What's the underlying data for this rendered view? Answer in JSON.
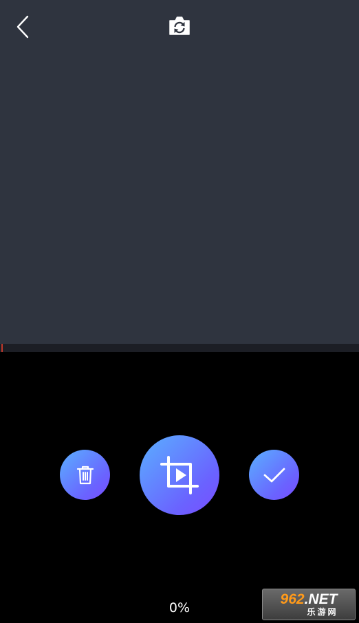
{
  "header": {
    "back_icon": "chevron-left-icon",
    "switch_camera_icon": "camera-switch-icon"
  },
  "controls": {
    "delete_icon": "trash-icon",
    "record_icon": "crop-play-icon",
    "confirm_icon": "checkmark-icon"
  },
  "progress": {
    "text": "0%",
    "value": 0
  },
  "watermark": {
    "number": "962",
    "suffix": ".NET",
    "caption": "乐游网"
  },
  "colors": {
    "preview_bg": "#2f343f",
    "strip_bg": "#1c1e25",
    "gradient_start": "#5ab0ff",
    "gradient_end": "#7a4dff",
    "background": "#000000"
  }
}
